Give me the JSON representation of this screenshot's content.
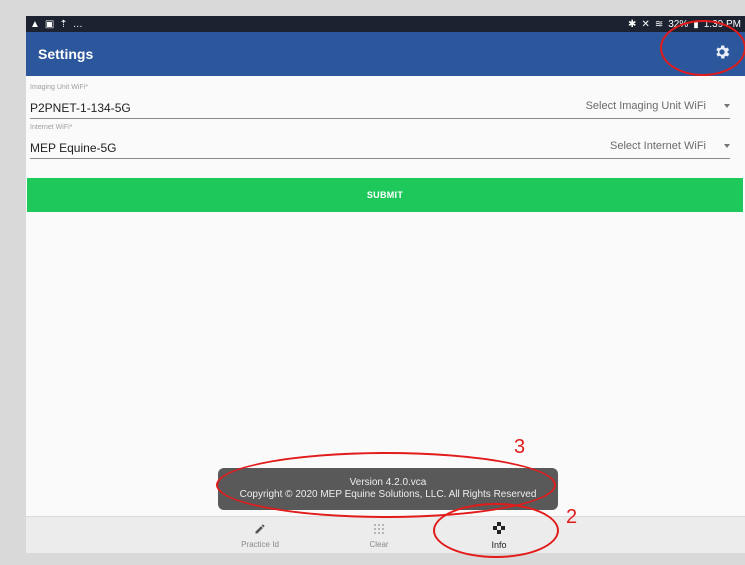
{
  "statusbar": {
    "left_icons": [
      "warning-icon",
      "image-icon",
      "upload-icon"
    ],
    "left_more": "…",
    "right_text": "32%",
    "time": "1:39 PM"
  },
  "appbar": {
    "title": "Settings"
  },
  "imaging_field": {
    "label": "Imaging Unit WiFi*",
    "value": "P2PNET-1-134-5G",
    "select_placeholder": "Select Imaging Unit WiFi"
  },
  "internet_field": {
    "label": "Internet WiFi*",
    "value": "MEP Equine-5G",
    "select_placeholder": "Select Internet WiFi"
  },
  "submit_label": "SUBMIT",
  "toast": {
    "line1": "Version 4.2.0.vca",
    "line2": "Copyright © 2020 MEP Equine Solutions, LLC. All Rights Reserved"
  },
  "bottomnav": {
    "items": [
      {
        "label": "Practice Id",
        "icon": "pencil-icon"
      },
      {
        "label": "Clear",
        "icon": "grid-icon"
      },
      {
        "label": "Info",
        "icon": "info-icon"
      }
    ]
  },
  "annotations": {
    "two": "2",
    "three": "3"
  },
  "colors": {
    "appbar": "#2c579c",
    "submit": "#1ec85a",
    "annotation": "#e21b1b"
  }
}
